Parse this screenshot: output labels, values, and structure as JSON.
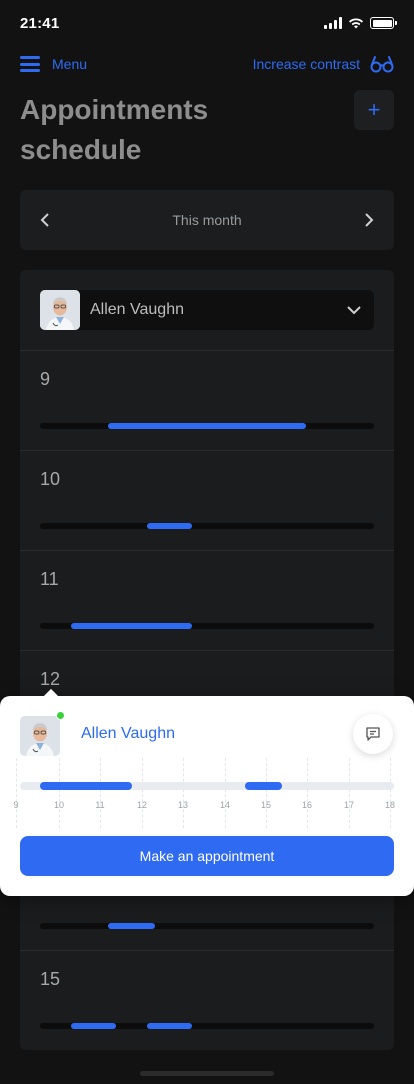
{
  "status": {
    "time": "21:41"
  },
  "topbar": {
    "menu_label": "Menu",
    "contrast_label": "Increase contrast"
  },
  "page": {
    "title_line1": "Appointments",
    "title_line2": "schedule",
    "add_label": "+"
  },
  "period": {
    "label": "This month"
  },
  "doctor": {
    "name": "Allen Vaughn"
  },
  "hours": [
    {
      "label": "9"
    },
    {
      "label": "10"
    },
    {
      "label": "11"
    },
    {
      "label": "12"
    },
    {
      "label": ""
    },
    {
      "label": ""
    },
    {
      "label": "15"
    }
  ],
  "popup": {
    "name": "Allen Vaughn",
    "button_label": "Make an appointment",
    "scale_labels": [
      "9",
      "10",
      "11",
      "12",
      "13",
      "14",
      "15",
      "16",
      "17",
      "18"
    ]
  },
  "colors": {
    "accent": "#2e6bf2",
    "background": "#121212",
    "card": "#1b1c1e",
    "online": "#3ad13a"
  }
}
